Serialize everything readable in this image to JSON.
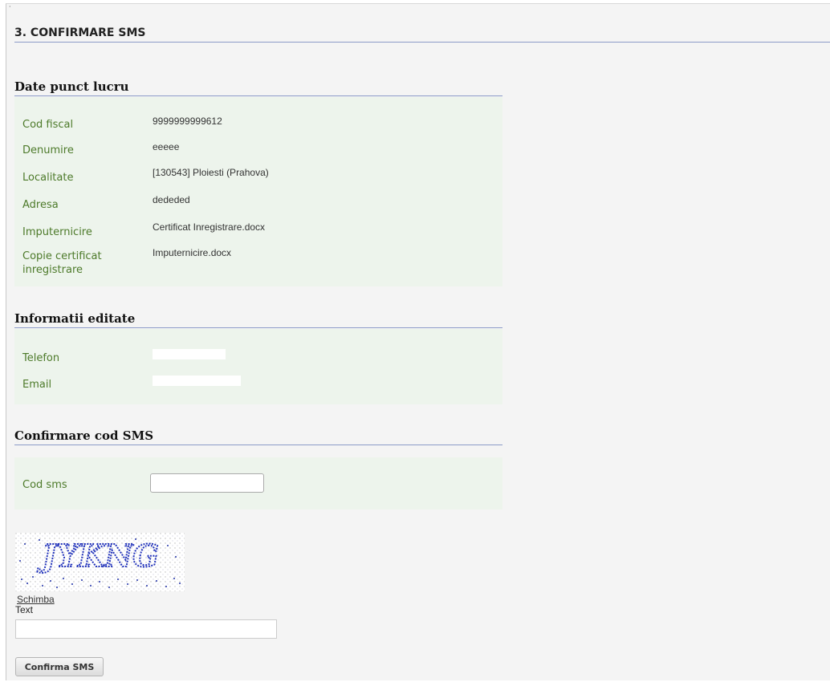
{
  "page_title": "3. CONFIRMARE SMS",
  "sections": {
    "date_punct": {
      "title": "Date punct lucru",
      "rows": [
        {
          "label": "Cod fiscal",
          "value": "9999999999612"
        },
        {
          "label": "Denumire",
          "value": "eeeee"
        },
        {
          "label": "Localitate",
          "value": "[130543] Ploiesti (Prahova)"
        },
        {
          "label": "Adresa",
          "value": "dededed"
        },
        {
          "label": "Imputernicire",
          "value": "Certificat Inregistrare.docx"
        },
        {
          "label": "Copie certificat inregistrare",
          "value": "Imputernicire.docx"
        }
      ]
    },
    "informatii": {
      "title": "Informatii editate",
      "rows": [
        {
          "label": "Telefon",
          "value": ""
        },
        {
          "label": "Email",
          "value": ""
        }
      ]
    },
    "confirmare": {
      "title": "Confirmare cod SMS",
      "cod_label": "Cod sms",
      "cod_value": ""
    }
  },
  "captcha": {
    "text": "JYKNG",
    "change_link": "Schimba",
    "input_label": "Text",
    "input_value": ""
  },
  "submit_label": "Confirma SMS"
}
